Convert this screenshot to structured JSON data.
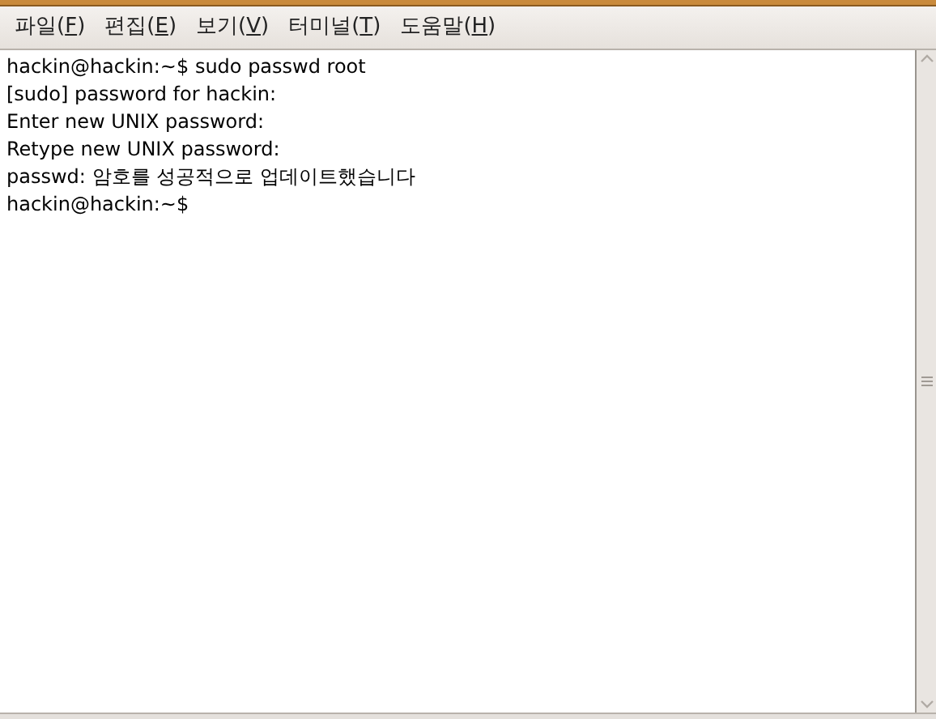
{
  "menu": [
    {
      "before": "파일(",
      "mnemonic": "F",
      "after": ")"
    },
    {
      "before": "편집(",
      "mnemonic": "E",
      "after": ")"
    },
    {
      "before": "보기(",
      "mnemonic": "V",
      "after": ")"
    },
    {
      "before": "터미널(",
      "mnemonic": "T",
      "after": ")"
    },
    {
      "before": "도움말(",
      "mnemonic": "H",
      "after": ")"
    }
  ],
  "terminal_lines": [
    "hackin@hackin:~$ sudo passwd root",
    "[sudo] password for hackin:",
    "Enter new UNIX password:",
    "Retype new UNIX password:",
    "passwd: 암호를 성공적으로 업데이트했습니다",
    "hackin@hackin:~$"
  ]
}
